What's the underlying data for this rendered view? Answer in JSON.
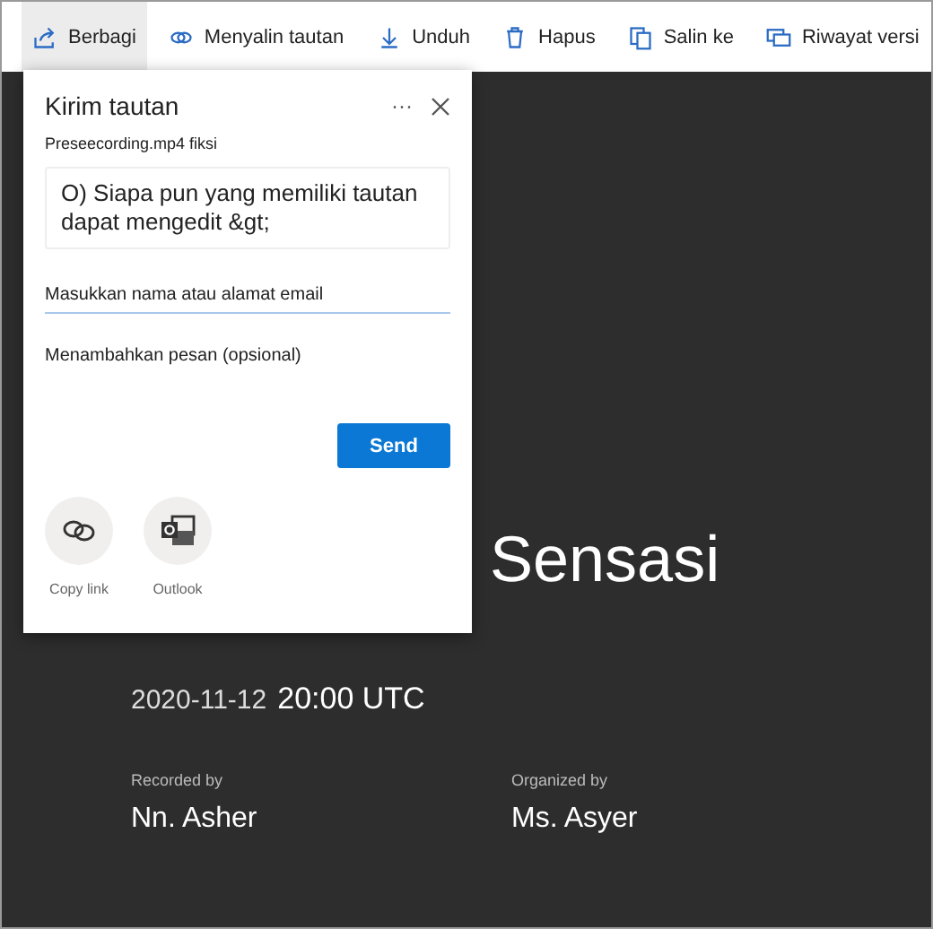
{
  "toolbar": [
    {
      "kind": "share",
      "label": "Berbagi",
      "selected": true
    },
    {
      "kind": "link",
      "label": "Menyalin tautan",
      "selected": false
    },
    {
      "kind": "download",
      "label": "Unduh",
      "selected": false
    },
    {
      "kind": "delete",
      "label": "Hapus",
      "selected": false
    },
    {
      "kind": "copy",
      "label": "Salin ke",
      "selected": false
    },
    {
      "kind": "history",
      "label": "Riwayat versi",
      "selected": false
    }
  ],
  "dialog": {
    "title": "Kirim tautan",
    "more": "···",
    "file": "Preseecording.mp4 fiksi",
    "permission": "O) Siapa pun yang memiliki tautan dapat mengedit &gt;",
    "recipient": {
      "placeholder": "Masukkan nama atau alamat email"
    },
    "message": {
      "placeholder": "Menambahkan pesan (opsional)"
    },
    "send": "Send",
    "options": [
      {
        "kind": "copy-link",
        "label": "Copy link"
      },
      {
        "kind": "outlook",
        "label": "Outlook"
      }
    ]
  },
  "recording": {
    "title": "Sensasi",
    "date": "2020-11-12",
    "time": "20:00 UTC",
    "people": [
      {
        "label": "Recorded by",
        "name": "Nn. Asher"
      },
      {
        "label": "Organized by",
        "name": "Ms. Asyer"
      }
    ]
  }
}
